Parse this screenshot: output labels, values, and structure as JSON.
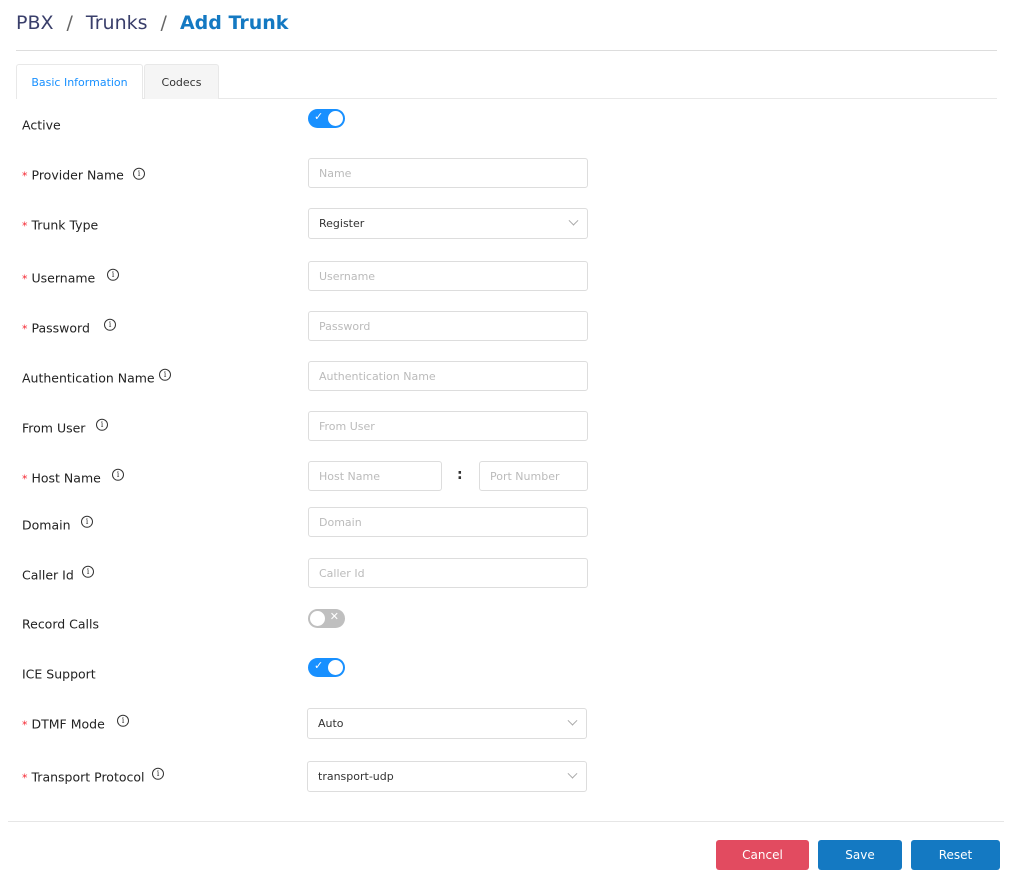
{
  "breadcrumb": {
    "items": [
      "PBX",
      "Trunks"
    ],
    "current": "Add Trunk",
    "separator": "/"
  },
  "tabs": [
    "Basic Information",
    "Codecs"
  ],
  "fields": {
    "active": {
      "label": "Active",
      "value": true
    },
    "provider_name": {
      "label": "Provider Name",
      "placeholder": "Name"
    },
    "trunk_type": {
      "label": "Trunk Type",
      "value": "Register"
    },
    "username": {
      "label": "Username",
      "placeholder": "Username"
    },
    "password": {
      "label": "Password",
      "placeholder": "Password"
    },
    "auth_name": {
      "label": "Authentication Name",
      "placeholder": "Authentication Name"
    },
    "from_user": {
      "label": "From User",
      "placeholder": "From User"
    },
    "host_name": {
      "label": "Host Name",
      "placeholder": "Host Name",
      "port_placeholder": "Port Number",
      "colon": ":"
    },
    "domain": {
      "label": "Domain",
      "placeholder": "Domain"
    },
    "caller_id": {
      "label": "Caller Id",
      "placeholder": "Caller Id"
    },
    "record_calls": {
      "label": "Record Calls",
      "value": false
    },
    "ice_support": {
      "label": "ICE Support",
      "value": true
    },
    "dtmf_mode": {
      "label": "DTMF Mode",
      "value": "Auto"
    },
    "transport_protocol": {
      "label": "Transport Protocol",
      "value": "transport-udp"
    }
  },
  "required_mark": "*",
  "icons": {
    "info": "i",
    "check": "✓",
    "cross": "✕"
  },
  "buttons": {
    "cancel": "Cancel",
    "save": "Save",
    "reset": "Reset"
  },
  "colors": {
    "primary": "#1479c2",
    "toggle_on": "#1890ff",
    "danger": "#e24b60"
  }
}
